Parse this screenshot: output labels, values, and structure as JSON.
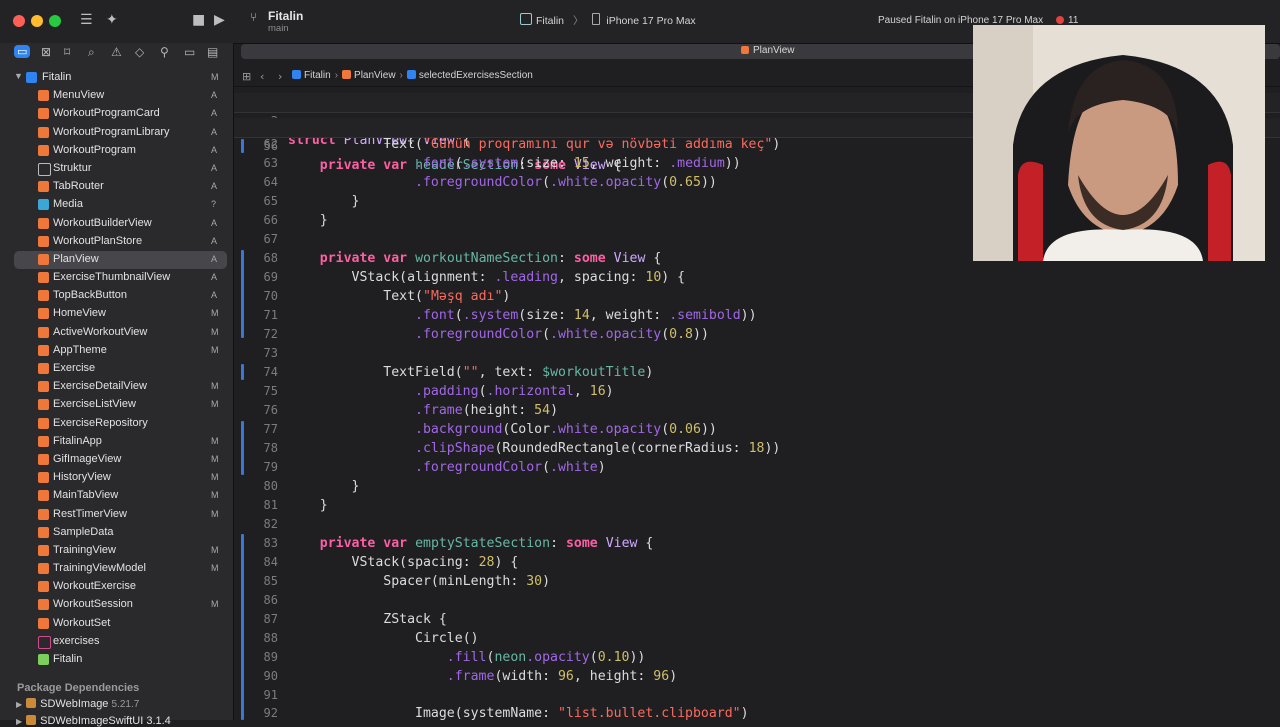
{
  "window": {
    "project_name": "Fitalin",
    "branch": "main",
    "scheme_target": "Fitalin",
    "scheme_chevron": "〉",
    "device": "iPhone 17 Pro Max",
    "status": "Paused Fitalin on iPhone 17 Pro Max",
    "error_count": "11",
    "active_tab": "PlanView"
  },
  "colors": {
    "accent": "#2f84f0",
    "swift_file": "#f0773a",
    "keyword": "#fc5fa3",
    "string": "#fc6a5d",
    "number": "#d0bf69"
  },
  "sidebar": {
    "root": {
      "name": "Fitalin",
      "flag": "M"
    },
    "items": [
      {
        "name": "MenuView",
        "flag": "A"
      },
      {
        "name": "WorkoutProgramCard",
        "flag": "A"
      },
      {
        "name": "WorkoutProgramLibrary",
        "flag": "A"
      },
      {
        "name": "WorkoutProgram",
        "flag": "A"
      },
      {
        "name": "Struktur",
        "flag": "A"
      },
      {
        "name": "TabRouter",
        "flag": "A"
      },
      {
        "name": "Media",
        "flag": "?"
      },
      {
        "name": "WorkoutBuilderView",
        "flag": "A"
      },
      {
        "name": "WorkoutPlanStore",
        "flag": "A"
      },
      {
        "name": "PlanView",
        "flag": "A"
      },
      {
        "name": "ExerciseThumbnailView",
        "flag": "A"
      },
      {
        "name": "TopBackButton",
        "flag": "A"
      },
      {
        "name": "HomeView",
        "flag": "M"
      },
      {
        "name": "ActiveWorkoutView",
        "flag": "M"
      },
      {
        "name": "AppTheme",
        "flag": "M"
      },
      {
        "name": "Exercise",
        "flag": ""
      },
      {
        "name": "ExerciseDetailView",
        "flag": "M"
      },
      {
        "name": "ExerciseListView",
        "flag": "M"
      },
      {
        "name": "ExerciseRepository",
        "flag": ""
      },
      {
        "name": "FitalinApp",
        "flag": "M"
      },
      {
        "name": "GifImageView",
        "flag": "M"
      },
      {
        "name": "HistoryView",
        "flag": "M"
      },
      {
        "name": "MainTabView",
        "flag": "M"
      },
      {
        "name": "RestTimerView",
        "flag": "M"
      },
      {
        "name": "SampleData",
        "flag": ""
      },
      {
        "name": "TrainingView",
        "flag": "M"
      },
      {
        "name": "TrainingViewModel",
        "flag": "M"
      },
      {
        "name": "WorkoutExercise",
        "flag": ""
      },
      {
        "name": "WorkoutSession",
        "flag": "M"
      },
      {
        "name": "WorkoutSet",
        "flag": ""
      },
      {
        "name": "exercises",
        "flag": ""
      },
      {
        "name": "Fitalin",
        "flag": ""
      }
    ],
    "packages_title": "Package Dependencies",
    "package_1": "SDWebImage",
    "package_1_version": "5.21.7",
    "package_2": "SDWebImageSwiftUI 3.1.4"
  },
  "breadcrumb": {
    "project": "Fitalin",
    "file": "PlanView",
    "symbol": "selectedExercisesSection"
  },
  "code": {
    "sticky_1_no": "3",
    "sticky_2_no": "56",
    "lines": [
      {
        "no": "62"
      },
      {
        "no": "63"
      },
      {
        "no": "64"
      },
      {
        "no": "65"
      },
      {
        "no": "66"
      },
      {
        "no": "67"
      },
      {
        "no": "68"
      },
      {
        "no": "69"
      },
      {
        "no": "70"
      },
      {
        "no": "71"
      },
      {
        "no": "72"
      },
      {
        "no": "73"
      },
      {
        "no": "74"
      },
      {
        "no": "75"
      },
      {
        "no": "76"
      },
      {
        "no": "77"
      },
      {
        "no": "78"
      },
      {
        "no": "79"
      },
      {
        "no": "80"
      },
      {
        "no": "81"
      },
      {
        "no": "82"
      },
      {
        "no": "83"
      },
      {
        "no": "84"
      },
      {
        "no": "85"
      },
      {
        "no": "86"
      },
      {
        "no": "87"
      },
      {
        "no": "88"
      },
      {
        "no": "89"
      },
      {
        "no": "90"
      },
      {
        "no": "91"
      },
      {
        "no": "92"
      }
    ],
    "t": {
      "struct": "struct",
      "PlanView": "PlanView",
      "colon": ":",
      "View": "View",
      "lbrace": "{",
      "rbrace": "}",
      "private": "private",
      "var": "var",
      "some": "some",
      "headerSection": "headerSection",
      "workoutNameSection": "workoutNameSection",
      "emptyStateSection": "emptyStateSection",
      "Text": "Text",
      "VStack": "VStack",
      "TextField": "TextField",
      "ZStack": "ZStack",
      "Circle": "Circle",
      "Spacer": "Spacer",
      "Image": "Image",
      "s62": "\"Günün proqramını qur və növbəti addıma keç\"",
      "s70": "\"Məşq adı\"",
      "s74": "\"\"",
      "s92": "\"list.bullet.clipboard\"",
      "font": ".font",
      "system": ".system",
      "size": "size:",
      "weight": "weight:",
      "medium": ".medium",
      "semibold": ".semibold",
      "foregroundColor": ".foregroundColor",
      "white": ".white",
      "opacity": ".opacity",
      "n15": "15",
      "n065": "0.65",
      "n14": "14",
      "n08": "0.8",
      "n10": "10",
      "n16": "16",
      "n54": "54",
      "n006": "0.06",
      "n18": "18",
      "n28": "28",
      "n30": "30",
      "n010": "0.10",
      "n96": "96",
      "alignment": "alignment:",
      "leading": ".leading",
      "spacing": "spacing:",
      "text": "text:",
      "workoutTitle": "$workoutTitle",
      "padding": ".padding",
      "horizontal": ".horizontal",
      "frame": ".frame",
      "height": "height:",
      "width": "width:",
      "background": ".background",
      "Color": "Color",
      "clipShape": ".clipShape",
      "RoundedRectangle": "RoundedRectangle",
      "cornerRadius": "cornerRadius:",
      "minLength": "minLength:",
      "fill": ".fill",
      "neon": "neon",
      "systemName": "systemName:"
    }
  }
}
